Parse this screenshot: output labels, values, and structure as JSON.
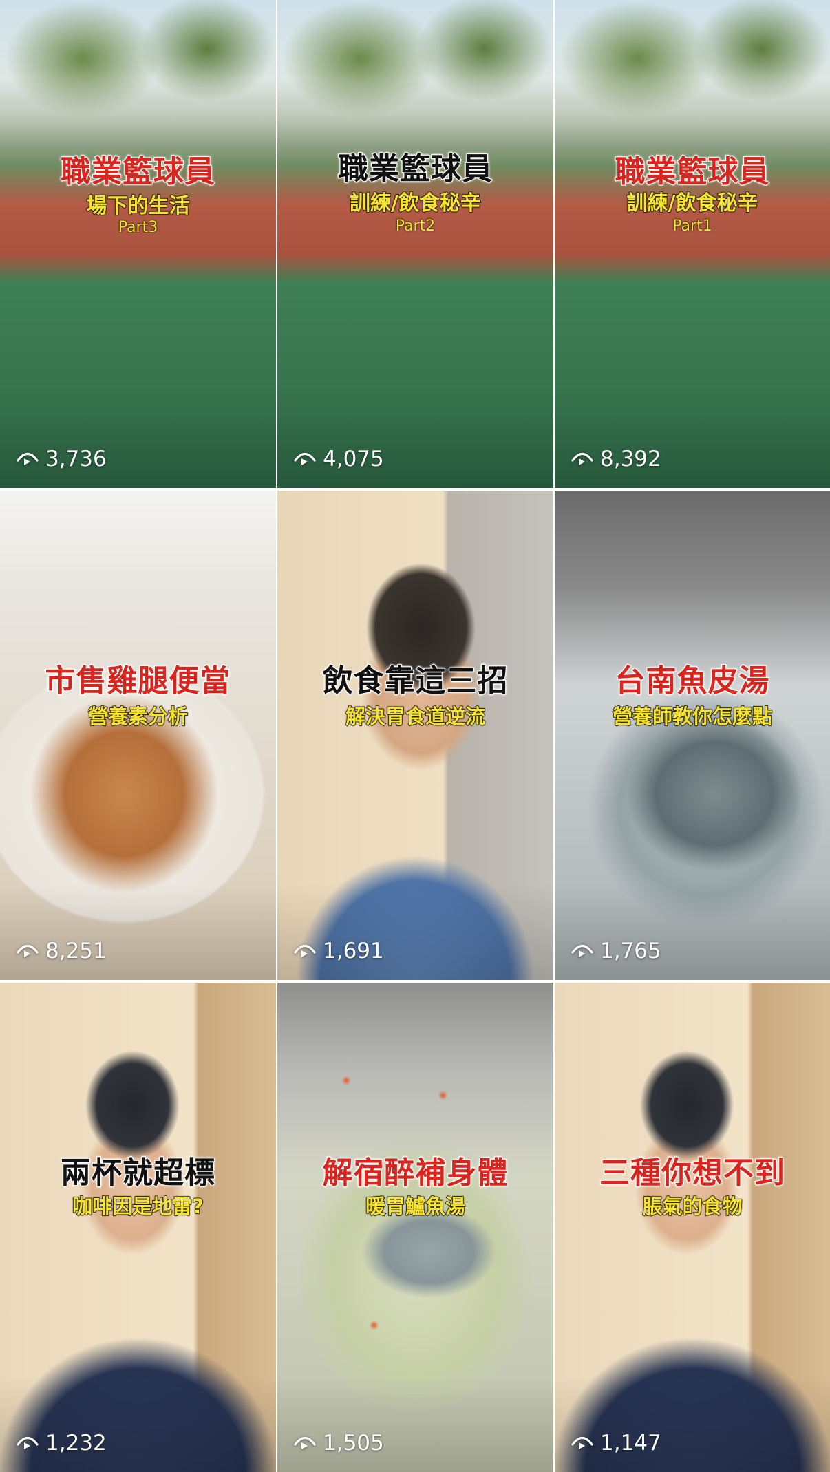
{
  "tiles": [
    {
      "title": "職業籃球員",
      "title_color": "red",
      "subtitle": "場下的生活",
      "part": "Part3",
      "views": "3,736",
      "scene": "court"
    },
    {
      "title": "職業籃球員",
      "title_color": "black",
      "subtitle": "訓練/飲食秘辛",
      "part": "Part2",
      "views": "4,075",
      "scene": "court"
    },
    {
      "title": "職業籃球員",
      "title_color": "red",
      "subtitle": "訓練/飲食秘辛",
      "part": "Part1",
      "views": "8,392",
      "scene": "court"
    },
    {
      "title": "市售雞腿便當",
      "title_color": "red",
      "subtitle": "營養素分析",
      "views": "8,251",
      "scene": "food"
    },
    {
      "title": "飲食靠這三招",
      "title_color": "black",
      "subtitle": "解決胃食道逆流",
      "views": "1,691",
      "scene": "room"
    },
    {
      "title": "台南魚皮湯",
      "title_color": "red",
      "subtitle": "營養師教你怎麼點",
      "views": "1,765",
      "scene": "soup"
    },
    {
      "title": "兩杯就超標",
      "title_color": "black",
      "subtitle": "咖啡因是地雷?",
      "views": "1,232",
      "scene": "navy"
    },
    {
      "title": "解宿醉補身體",
      "title_color": "red",
      "subtitle": "暖胃鱸魚湯",
      "views": "1,505",
      "scene": "fish"
    },
    {
      "title": "三種你想不到",
      "title_color": "red",
      "subtitle": "脹氣的食物",
      "views": "1,147",
      "scene": "navy"
    }
  ],
  "colors": {
    "title_red": "#d8261f",
    "title_black": "#111111",
    "subtitle_yellow": "#f6e32a",
    "view_count_white": "#ffffff"
  },
  "icons": {
    "views": "play-eye-icon"
  }
}
